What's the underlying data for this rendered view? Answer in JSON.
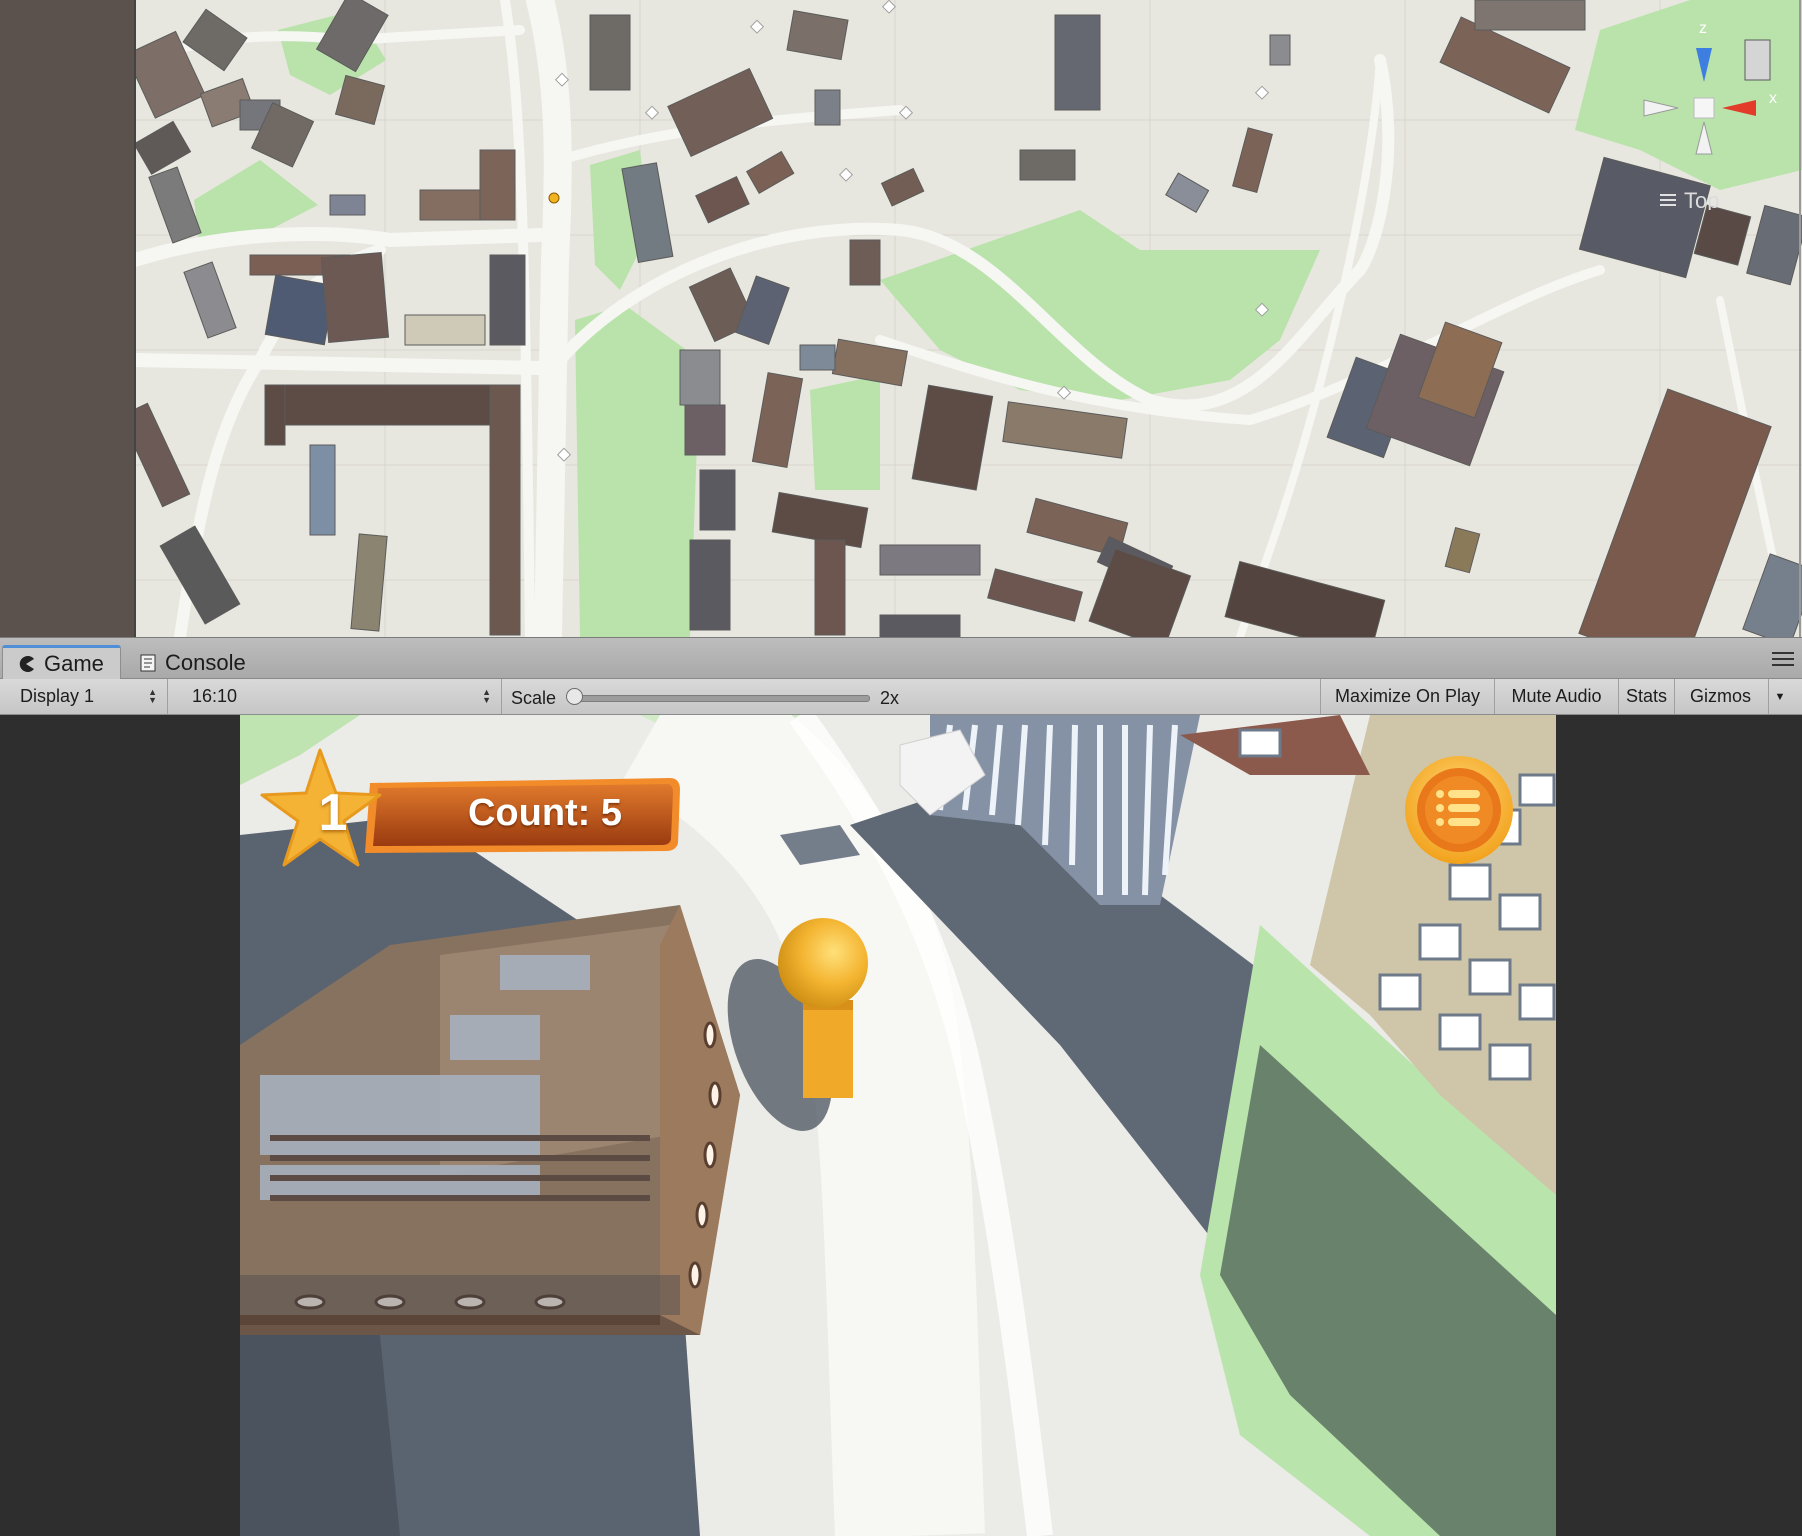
{
  "scene": {
    "gizmo": {
      "z_label": "z",
      "x_label": "x",
      "view_label": "Top"
    }
  },
  "tabs": [
    {
      "label": "Game",
      "icon": "pacman-icon"
    },
    {
      "label": "Console",
      "icon": "console-icon"
    }
  ],
  "toolbar": {
    "display": "Display 1",
    "aspect": "16:10",
    "scale_label": "Scale",
    "scale_value": "2x",
    "scale_level": 0.0,
    "maximize": "Maximize On Play",
    "mute": "Mute Audio",
    "stats": "Stats",
    "gizmos": "Gizmos"
  },
  "game": {
    "level": "1",
    "count_text": "Count: 5"
  },
  "colors": {
    "accent_tab": "#4f8fd8",
    "hud_orange": "#c2551a",
    "star_gold": "#f5b335",
    "park_green": "#b7e3a9",
    "road": "#f7f7f4",
    "ground": "#e7e6df"
  }
}
